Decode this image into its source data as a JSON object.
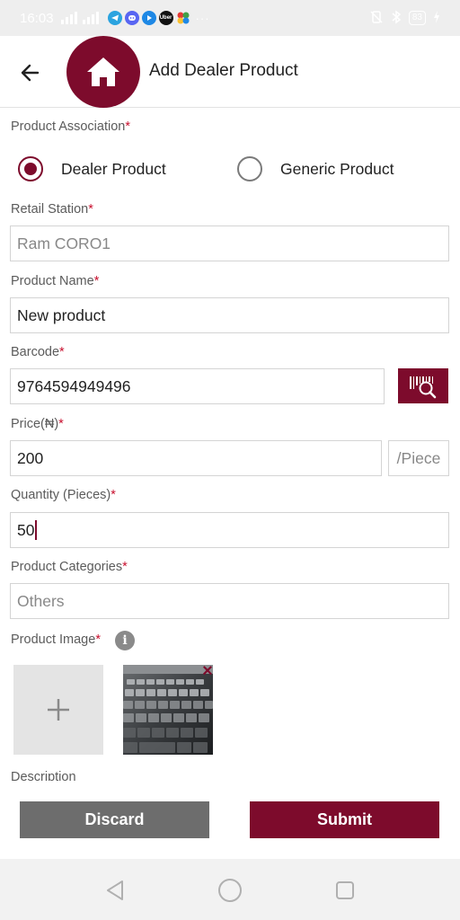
{
  "status_bar": {
    "time": "16:03",
    "apps": [
      {
        "icon": "telegram-icon",
        "color": "#2aa3df"
      },
      {
        "icon": "discord-icon",
        "color": "#5865f2"
      },
      {
        "icon": "play-icon",
        "color": "#1e88e5"
      },
      {
        "icon": "uber-icon",
        "color": "#111111",
        "text": "Uber"
      },
      {
        "icon": "pinwheel-icon",
        "color": "#ffffff"
      }
    ],
    "dots": "···",
    "battery": "83"
  },
  "header": {
    "title": "Add Dealer Product",
    "logo_icon": "home-icon",
    "back_icon": "arrow-left-icon",
    "brand_color": "#7d0b2c"
  },
  "form": {
    "required_mark": "*",
    "product_association": {
      "label": "Product Association",
      "options": [
        {
          "label": "Dealer Product",
          "selected": true
        },
        {
          "label": "Generic Product",
          "selected": false
        }
      ]
    },
    "retail_station": {
      "label": "Retail Station",
      "value": "Ram CORO1"
    },
    "product_name": {
      "label": "Product Name",
      "value": "New product"
    },
    "barcode": {
      "label": "Barcode",
      "value": "9764594949496",
      "scan_icon": "barcode-scan-icon"
    },
    "price": {
      "label": "Price(₦)",
      "value": "200",
      "unit": "/Piece"
    },
    "quantity": {
      "label": "Quantity (Pieces)",
      "value": "50"
    },
    "product_categories": {
      "label": "Product Categories",
      "value": "Others"
    },
    "product_image": {
      "label": "Product Image",
      "info_icon": "info-icon",
      "info_glyph": "i",
      "add_glyph": "+",
      "remove_glyph": "×"
    },
    "description": {
      "label": "Description"
    }
  },
  "actions": {
    "discard_label": "Discard",
    "submit_label": "Submit"
  },
  "nav_bar": {
    "back_icon": "triangle-back-icon",
    "home_icon": "circle-home-icon",
    "recents_icon": "square-recents-icon"
  }
}
